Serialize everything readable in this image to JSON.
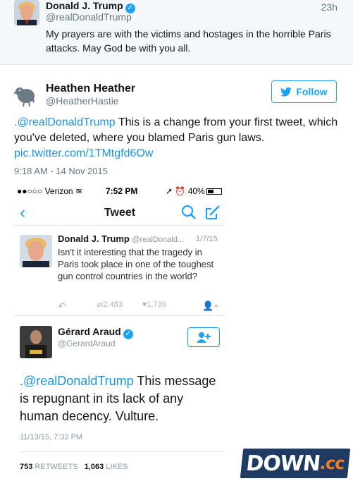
{
  "context_tweet": {
    "name": "Donald J. Trump",
    "handle": "@realDonaldTrump",
    "time": "23h",
    "text": "My prayers are with the victims and hostages in the horrible Paris attacks. May God be with you all."
  },
  "main_tweet": {
    "name": "Heathen Heather",
    "handle": "@HeatherHastie",
    "follow_label": "Follow",
    "mention": ".@realDonaldTrump",
    "text": " This is a change from your first tweet, which you've deleted, where you blamed Paris gun laws.",
    "link": "pic.twitter.com/1TMtgfd6Ow",
    "timestamp": "9:18 AM - 14 Nov 2015"
  },
  "screenshot": {
    "status": {
      "carrier": "●●○○○ Verizon",
      "time": "7:52 PM",
      "battery": "40%"
    },
    "nav_title": "Tweet",
    "quoted": {
      "name": "Donald J. Trump",
      "handle": "@realDonald...",
      "date": "1/7/15",
      "text": "Isn't it interesting that the tragedy in Paris took place in one of the toughest gun control countries in the world?",
      "retweets": "2,483",
      "likes": "1,739"
    },
    "reply": {
      "name": "Gérard Araud",
      "handle": "@GerardAraud",
      "mention": ".@realDonaldTrump",
      "text": " This message is repugnant in its lack of any human decency. Vulture.",
      "time": "11/13/15, 7:32 PM",
      "retweet_count": "753",
      "retweets_label": "RETWEETS",
      "like_count": "1,063",
      "likes_label": "LIKES"
    }
  },
  "watermark": {
    "main": "DOWN",
    "suffix": ".cc"
  },
  "colors": {
    "accent": "#1da1f2",
    "link": "#1b95e0",
    "muted": "#657786",
    "context_bg": "#f5f8fa",
    "watermark_bg": "#1f3a63",
    "watermark_accent": "#f47c20"
  }
}
